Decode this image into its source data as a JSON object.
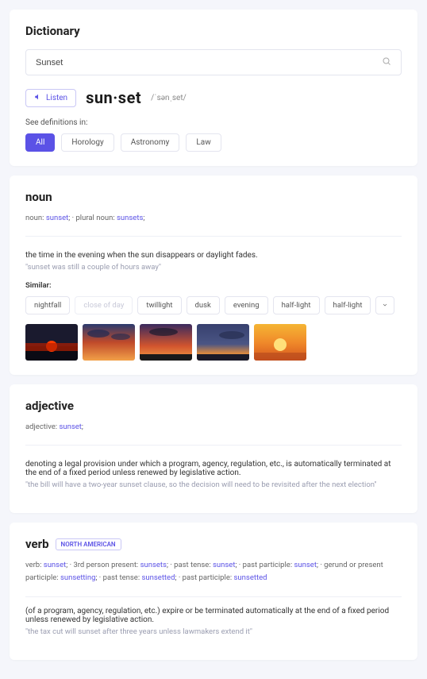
{
  "header": {
    "title": "Dictionary",
    "search_value": "Sunset",
    "listen_label": "Listen",
    "headword": "sun·set",
    "pronunciation": "/ˈsənˌset/",
    "see_definitions_label": "See definitions in:",
    "categories": {
      "all": "All",
      "horology": "Horology",
      "astronomy": "Astronomy",
      "law": "Law"
    }
  },
  "noun": {
    "title": "noun",
    "forms_prefix": "noun: ",
    "forms_word1": "sunset",
    "forms_sep": ";   ·   plural noun: ",
    "forms_word2": "sunsets",
    "forms_suffix": ";",
    "definition": "the time in the evening when the sun disappears or daylight fades.",
    "example": "\"sunset was still a couple of hours away\"",
    "similar_label": "Similar:",
    "similar": {
      "s0": "nightfall",
      "s1": "close of day",
      "s2": "twillight",
      "s3": "dusk",
      "s4": "evening",
      "s5": "half-light",
      "s6": "half-light"
    }
  },
  "adjective": {
    "title": "adjective",
    "forms_prefix": "adjective: ",
    "forms_word": "sunset",
    "forms_suffix": ";",
    "definition": "denoting a legal provision under which a program, agency, regulation, etc., is automatically terminated at the end of a fixed period unless renewed by legislative action.",
    "example": "\"the bill will have a two-year sunset clause, so the decision will need to be revisited after the next election\""
  },
  "verb": {
    "title": "verb",
    "region": "NORTH AMERICAN",
    "f_pre": "verb: ",
    "f_w1": "sunset",
    "f_s1": ";   ·   3rd person present: ",
    "f_w2": "sunsets",
    "f_s2": ";   ·   past tense: ",
    "f_w3": "sunset",
    "f_s3": ";   ·   past participle: ",
    "f_w4": "sunset",
    "f_s4": ";   ·   gerund or present participle: ",
    "f_w5": "sunsetting",
    "f_s5": ";   ·   past tense: ",
    "f_w6": "sunsetted",
    "f_s6": ";   ·   past participle: ",
    "f_w7": "sunsetted",
    "definition": "(of a program, agency, regulation, etc.) expire or be terminated automatically at the end of a fixed period unless renewed by legislative action.",
    "example": "\"the tax cut will sunset after three years unless lawmakers extend it\""
  }
}
